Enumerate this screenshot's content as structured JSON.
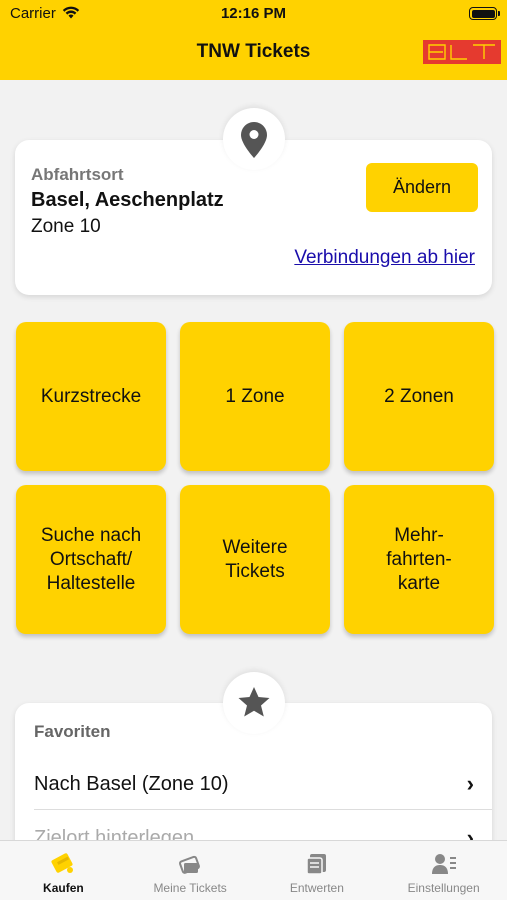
{
  "status": {
    "carrier": "Carrier",
    "time": "12:16 PM"
  },
  "header": {
    "title": "TNW Tickets",
    "logo_text": "BLT",
    "brand_color": "#ffd200",
    "logo_color": "#e53a2f"
  },
  "location": {
    "label": "Abfahrtsort",
    "name": "Basel, Aeschenplatz",
    "zone": "Zone 10",
    "change_button": "Ändern",
    "connections_link": "Verbindungen ab hier",
    "icon": "location-pin-icon"
  },
  "tickets": [
    {
      "label": "Kurzstrecke"
    },
    {
      "label": "1 Zone"
    },
    {
      "label": "2 Zonen"
    },
    {
      "label": "Suche nach Ortschaft/ Haltestelle"
    },
    {
      "label": "Weitere Tickets"
    },
    {
      "label": "Mehr- fahrten- karte"
    }
  ],
  "favorites": {
    "title": "Favoriten",
    "icon": "star-icon",
    "items": [
      {
        "label": "Nach Basel (Zone 10)"
      },
      {
        "label": "Zielort hinterlegen"
      }
    ]
  },
  "tabbar": {
    "items": [
      {
        "label": "Kaufen",
        "icon": "ticket-buy-icon",
        "active": true
      },
      {
        "label": "Meine Tickets",
        "icon": "my-tickets-icon",
        "active": false
      },
      {
        "label": "Entwerten",
        "icon": "validate-icon",
        "active": false
      },
      {
        "label": "Einstellungen",
        "icon": "settings-user-icon",
        "active": false
      }
    ]
  }
}
